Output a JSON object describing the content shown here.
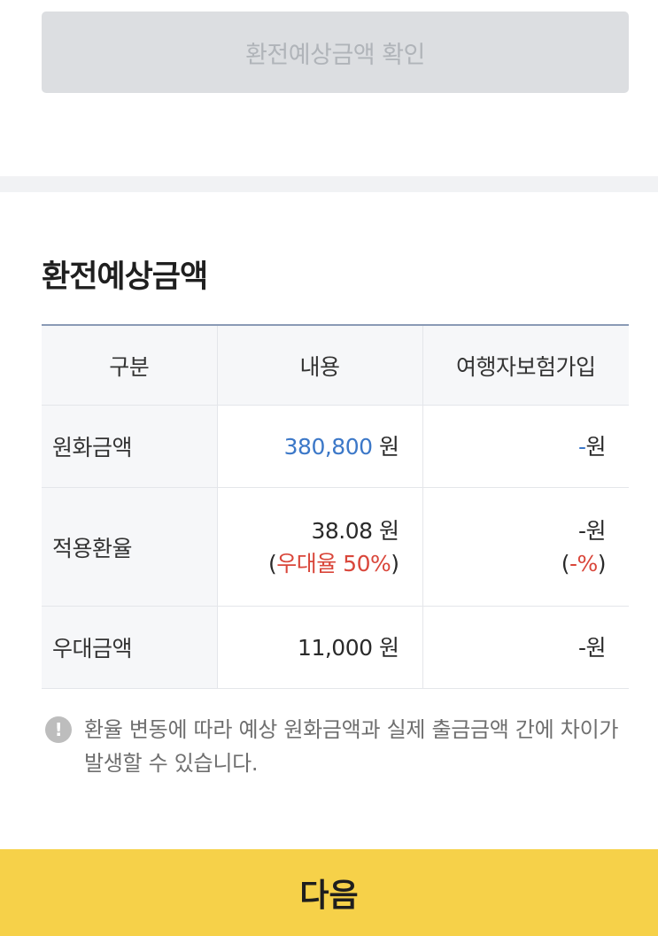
{
  "confirm_button": {
    "label": "환전예상금액 확인"
  },
  "section": {
    "title": "환전예상금액"
  },
  "table": {
    "headers": [
      "구분",
      "내용",
      "여행자보험가입"
    ],
    "rows": [
      {
        "label": "원화금액",
        "content": {
          "number": "380,800",
          "unit": "원"
        },
        "insurance": {
          "number": "-",
          "unit": "원"
        }
      },
      {
        "label": "적용환율",
        "content": {
          "number": "38.08",
          "unit": "원",
          "sub_open": "(",
          "sub_text": "우대율 50%",
          "sub_close": ")"
        },
        "insurance": {
          "number": "-",
          "unit": "원",
          "sub_open": "(",
          "sub_text": "-%",
          "sub_close": ")"
        }
      },
      {
        "label": "우대금액",
        "content": {
          "number": "11,000",
          "unit": "원"
        },
        "insurance": {
          "number": "-",
          "unit": "원"
        }
      }
    ]
  },
  "notice": {
    "icon": "exclamation-circle-icon",
    "text": "환율 변동에 따라 예상 원화금액과 실제 출금금액 간에 차이가 발생할 수 있습니다."
  },
  "next_button": {
    "label": "다음"
  },
  "colors": {
    "accent_blue": "#3c78c8",
    "accent_red": "#d9463a",
    "primary_button": "#f6d149",
    "disabled_button": "#dcdee1"
  }
}
